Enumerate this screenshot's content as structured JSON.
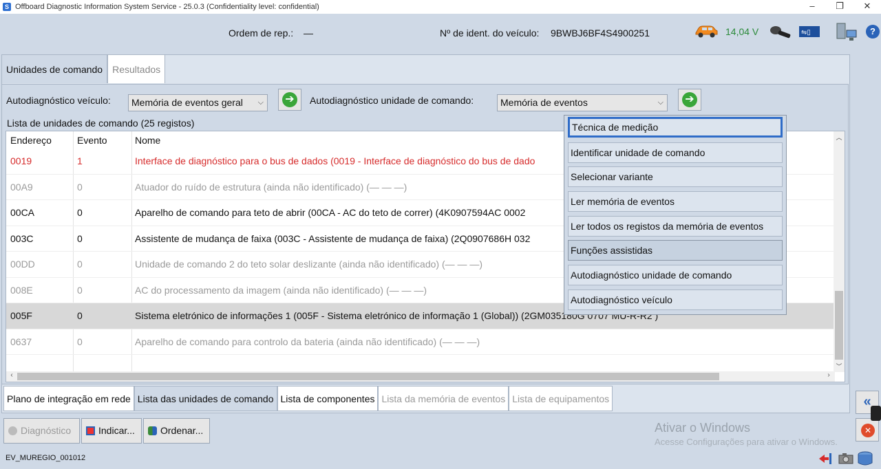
{
  "window": {
    "title": "Offboard Diagnostic Information System Service - 25.0.3 (Confidentiality level: confidential)",
    "minimize": "–",
    "maximize": "❐",
    "close": "✕"
  },
  "header": {
    "order_label": "Ordem de rep.:",
    "order_value": "—",
    "vin_label": "Nº de ident. do veículo:",
    "vin_value": "9BWBJ6BF4S4900251",
    "voltage": "14,04 V",
    "icons": [
      "car-icon",
      "key-icon",
      "usb-icon",
      "network-icon",
      "help-icon"
    ]
  },
  "tabs_top": [
    {
      "label": "Unidades de comando",
      "active": true
    },
    {
      "label": "Resultados",
      "active": false
    }
  ],
  "filters": {
    "vehicle_label": "Autodiagnóstico veículo:",
    "vehicle_select": "Memória de eventos geral",
    "unit_label": "Autodiagnóstico unidade de comando:",
    "unit_select": "Memória de eventos"
  },
  "list": {
    "caption": "Lista de unidades de comando (25 registos)",
    "columns": [
      "Endereço",
      "Evento",
      "Nome"
    ],
    "rows": [
      {
        "addr": "0019",
        "event": "1",
        "name": "Interface de diagnóstico para o bus de dados (0019 - Interface de diagnóstico do bus de dado",
        "style": "red"
      },
      {
        "addr": "00A9",
        "event": "0",
        "name": "Atuador do ruído de estrutura (ainda não identificado) (— — —)",
        "style": "gray"
      },
      {
        "addr": "00CA",
        "event": "0",
        "name": "Aparelho de comando para teto de abrir (00CA - AC do teto de correr) (4K0907594AC 0002",
        "style": "black"
      },
      {
        "addr": "003C",
        "event": "0",
        "name": "Assistente de mudança de faixa (003C - Assistente de mudança de faixa) (2Q0907686H 032",
        "style": "black"
      },
      {
        "addr": "00DD",
        "event": "0",
        "name": "Unidade de comando 2 do teto solar deslizante (ainda não identificado) (— — —)",
        "style": "gray"
      },
      {
        "addr": "008E",
        "event": "0",
        "name": "AC do processamento da imagem (ainda não identificado) (— — —)",
        "style": "gray"
      },
      {
        "addr": "005F",
        "event": "0",
        "name": "Sistema eletrónico de informações 1 (005F - Sistema eletrónico de informação 1 (Global)) (2GM035180G 0707 MU-R-R2 )",
        "style": "sel"
      },
      {
        "addr": "0637",
        "event": "0",
        "name": "Aparelho de comando para controlo da bateria (ainda não identificado) (— — —)",
        "style": "gray"
      }
    ]
  },
  "context_menu": [
    "Técnica de medição",
    "Identificar unidade de comando",
    "Selecionar variante",
    "Ler memória de eventos",
    "Ler todos os registos da memória de eventos",
    "Funções assistidas",
    "Autodiagnóstico unidade de comando",
    "Autodiagnóstico veículo"
  ],
  "bottom_tabs": [
    {
      "label": "Plano de integração em rede",
      "state": "normal"
    },
    {
      "label": "Lista das unidades de comando",
      "state": "active"
    },
    {
      "label": "Lista de componentes",
      "state": "normal"
    },
    {
      "label": "Lista da memória de eventos",
      "state": "dim"
    },
    {
      "label": "Lista de equipamentos",
      "state": "dim"
    }
  ],
  "actions": {
    "diagnostico": "Diagnóstico",
    "indicar": "Indicar...",
    "ordenar": "Ordenar..."
  },
  "watermark": {
    "line1": "Ativar o Windows",
    "line2": "Acesse Configurações para ativar o Windows."
  },
  "status": {
    "code": "EV_MUREGIO_001012"
  },
  "colors": {
    "accent_blue": "#2f6cc8",
    "error_red": "#d62b2b",
    "voltage_green": "#2b8a3a",
    "go_green": "#3aa63a"
  }
}
